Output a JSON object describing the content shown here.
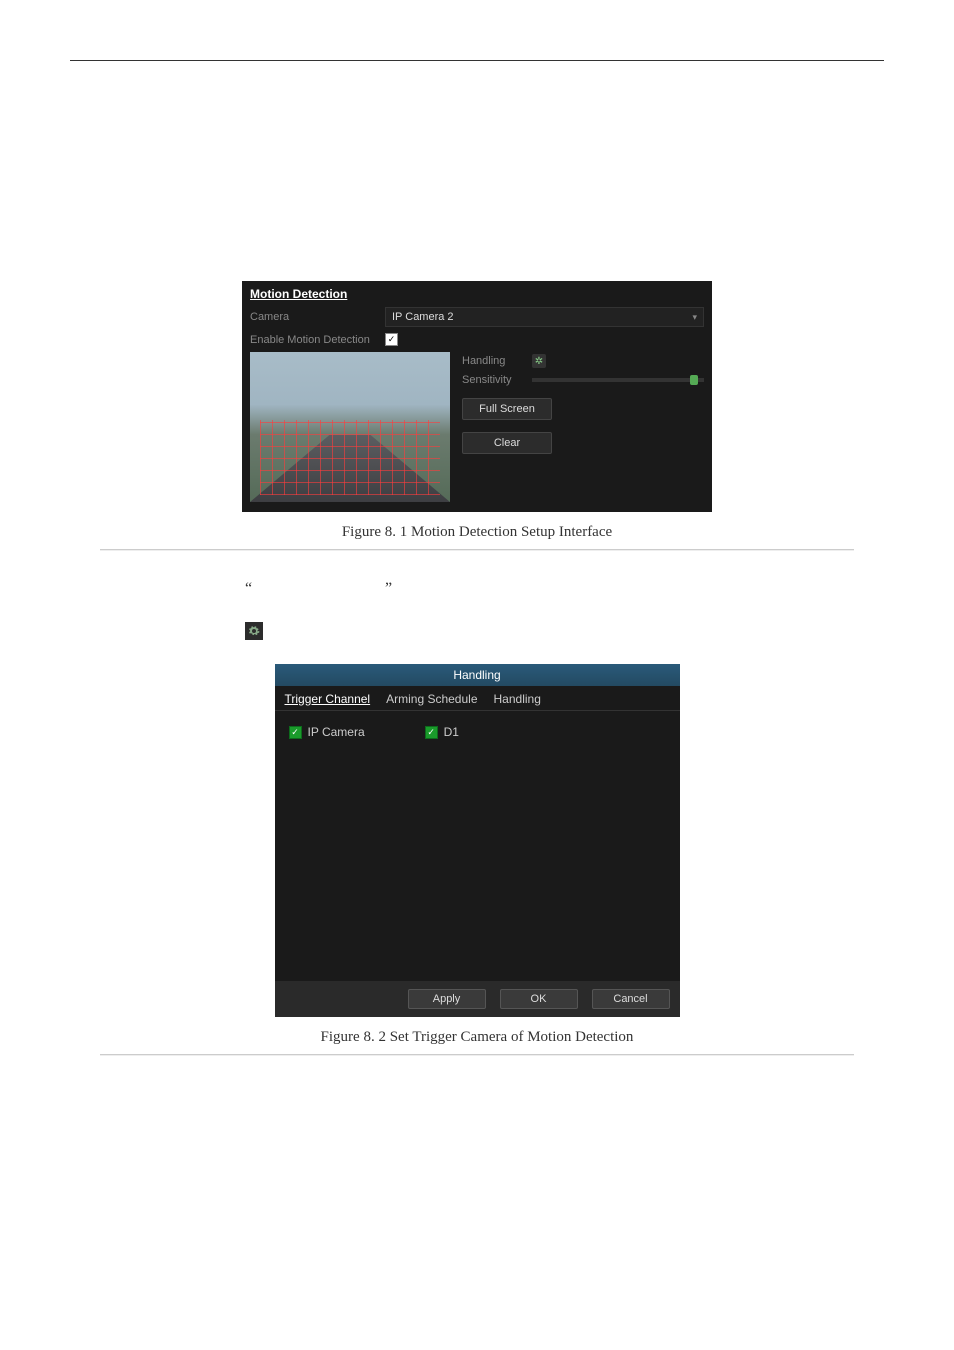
{
  "fig81": {
    "title": "Motion Detection",
    "camera_label": "Camera",
    "camera_value": "IP Camera 2",
    "enable_label": "Enable Motion Detection",
    "handling_label": "Handling",
    "sensitivity_label": "Sensitivity",
    "fullscreen_label": "Full Screen",
    "clear_label": "Clear"
  },
  "caption81": "Figure 8. 1  Motion Detection Setup Interface",
  "quotes": {
    "open": "“",
    "close": "”"
  },
  "fig82": {
    "dlg_title": "Handling",
    "tabs": [
      "Trigger Channel",
      "Arming Schedule",
      "Handling"
    ],
    "ipcam_label": "IP Camera",
    "d1_label": "D1",
    "apply": "Apply",
    "ok": "OK",
    "cancel": "Cancel"
  },
  "caption82": "Figure 8. 2  Set Trigger Camera of Motion Detection"
}
